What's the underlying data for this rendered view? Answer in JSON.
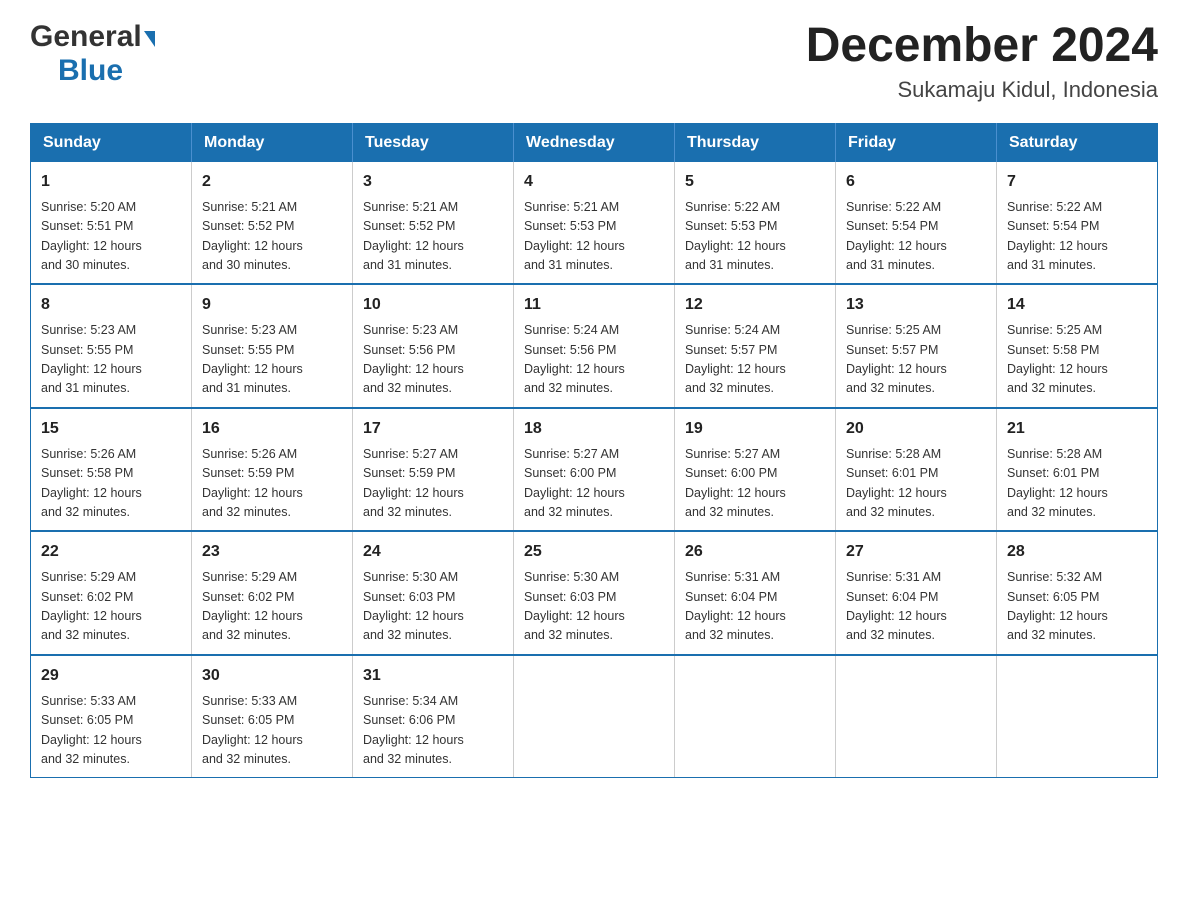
{
  "logo": {
    "general": "General",
    "blue": "Blue",
    "tagline": "GeneralBlue"
  },
  "header": {
    "month": "December 2024",
    "location": "Sukamaju Kidul, Indonesia"
  },
  "weekdays": [
    "Sunday",
    "Monday",
    "Tuesday",
    "Wednesday",
    "Thursday",
    "Friday",
    "Saturday"
  ],
  "weeks": [
    [
      {
        "day": "1",
        "sunrise": "5:20 AM",
        "sunset": "5:51 PM",
        "daylight": "12 hours and 30 minutes."
      },
      {
        "day": "2",
        "sunrise": "5:21 AM",
        "sunset": "5:52 PM",
        "daylight": "12 hours and 30 minutes."
      },
      {
        "day": "3",
        "sunrise": "5:21 AM",
        "sunset": "5:52 PM",
        "daylight": "12 hours and 31 minutes."
      },
      {
        "day": "4",
        "sunrise": "5:21 AM",
        "sunset": "5:53 PM",
        "daylight": "12 hours and 31 minutes."
      },
      {
        "day": "5",
        "sunrise": "5:22 AM",
        "sunset": "5:53 PM",
        "daylight": "12 hours and 31 minutes."
      },
      {
        "day": "6",
        "sunrise": "5:22 AM",
        "sunset": "5:54 PM",
        "daylight": "12 hours and 31 minutes."
      },
      {
        "day": "7",
        "sunrise": "5:22 AM",
        "sunset": "5:54 PM",
        "daylight": "12 hours and 31 minutes."
      }
    ],
    [
      {
        "day": "8",
        "sunrise": "5:23 AM",
        "sunset": "5:55 PM",
        "daylight": "12 hours and 31 minutes."
      },
      {
        "day": "9",
        "sunrise": "5:23 AM",
        "sunset": "5:55 PM",
        "daylight": "12 hours and 31 minutes."
      },
      {
        "day": "10",
        "sunrise": "5:23 AM",
        "sunset": "5:56 PM",
        "daylight": "12 hours and 32 minutes."
      },
      {
        "day": "11",
        "sunrise": "5:24 AM",
        "sunset": "5:56 PM",
        "daylight": "12 hours and 32 minutes."
      },
      {
        "day": "12",
        "sunrise": "5:24 AM",
        "sunset": "5:57 PM",
        "daylight": "12 hours and 32 minutes."
      },
      {
        "day": "13",
        "sunrise": "5:25 AM",
        "sunset": "5:57 PM",
        "daylight": "12 hours and 32 minutes."
      },
      {
        "day": "14",
        "sunrise": "5:25 AM",
        "sunset": "5:58 PM",
        "daylight": "12 hours and 32 minutes."
      }
    ],
    [
      {
        "day": "15",
        "sunrise": "5:26 AM",
        "sunset": "5:58 PM",
        "daylight": "12 hours and 32 minutes."
      },
      {
        "day": "16",
        "sunrise": "5:26 AM",
        "sunset": "5:59 PM",
        "daylight": "12 hours and 32 minutes."
      },
      {
        "day": "17",
        "sunrise": "5:27 AM",
        "sunset": "5:59 PM",
        "daylight": "12 hours and 32 minutes."
      },
      {
        "day": "18",
        "sunrise": "5:27 AM",
        "sunset": "6:00 PM",
        "daylight": "12 hours and 32 minutes."
      },
      {
        "day": "19",
        "sunrise": "5:27 AM",
        "sunset": "6:00 PM",
        "daylight": "12 hours and 32 minutes."
      },
      {
        "day": "20",
        "sunrise": "5:28 AM",
        "sunset": "6:01 PM",
        "daylight": "12 hours and 32 minutes."
      },
      {
        "day": "21",
        "sunrise": "5:28 AM",
        "sunset": "6:01 PM",
        "daylight": "12 hours and 32 minutes."
      }
    ],
    [
      {
        "day": "22",
        "sunrise": "5:29 AM",
        "sunset": "6:02 PM",
        "daylight": "12 hours and 32 minutes."
      },
      {
        "day": "23",
        "sunrise": "5:29 AM",
        "sunset": "6:02 PM",
        "daylight": "12 hours and 32 minutes."
      },
      {
        "day": "24",
        "sunrise": "5:30 AM",
        "sunset": "6:03 PM",
        "daylight": "12 hours and 32 minutes."
      },
      {
        "day": "25",
        "sunrise": "5:30 AM",
        "sunset": "6:03 PM",
        "daylight": "12 hours and 32 minutes."
      },
      {
        "day": "26",
        "sunrise": "5:31 AM",
        "sunset": "6:04 PM",
        "daylight": "12 hours and 32 minutes."
      },
      {
        "day": "27",
        "sunrise": "5:31 AM",
        "sunset": "6:04 PM",
        "daylight": "12 hours and 32 minutes."
      },
      {
        "day": "28",
        "sunrise": "5:32 AM",
        "sunset": "6:05 PM",
        "daylight": "12 hours and 32 minutes."
      }
    ],
    [
      {
        "day": "29",
        "sunrise": "5:33 AM",
        "sunset": "6:05 PM",
        "daylight": "12 hours and 32 minutes."
      },
      {
        "day": "30",
        "sunrise": "5:33 AM",
        "sunset": "6:05 PM",
        "daylight": "12 hours and 32 minutes."
      },
      {
        "day": "31",
        "sunrise": "5:34 AM",
        "sunset": "6:06 PM",
        "daylight": "12 hours and 32 minutes."
      },
      null,
      null,
      null,
      null
    ]
  ],
  "labels": {
    "sunrise": "Sunrise:",
    "sunset": "Sunset:",
    "daylight": "Daylight:"
  }
}
